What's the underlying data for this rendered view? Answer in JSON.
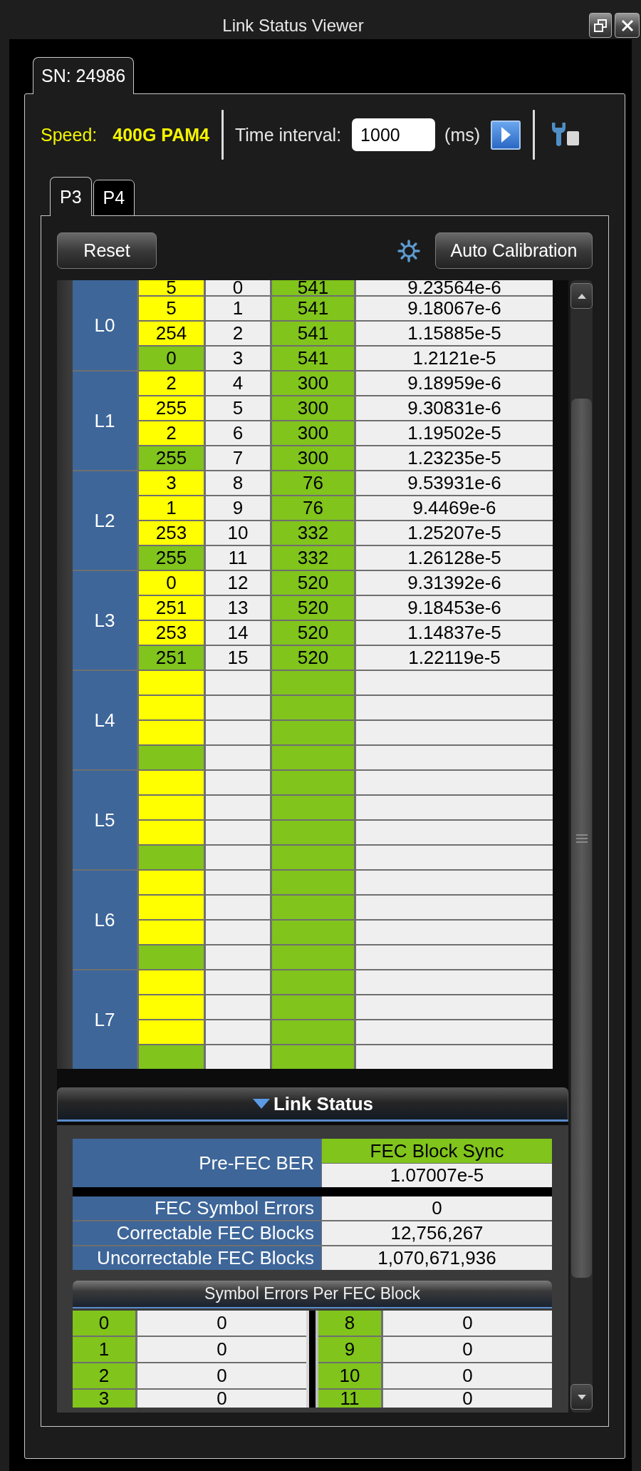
{
  "window": {
    "title": "Link Status Viewer"
  },
  "device_tabs": [
    {
      "label": "SN: 24986",
      "selected": true
    }
  ],
  "toolbar": {
    "speed_label": "Speed:",
    "speed_value": "400G PAM4",
    "interval_label": "Time interval:",
    "interval_value": "1000",
    "interval_unit": "(ms)"
  },
  "port_tabs": [
    {
      "label": "P3",
      "selected": true
    },
    {
      "label": "P4",
      "selected": false
    }
  ],
  "actions": {
    "reset": "Reset",
    "auto_calibration": "Auto Calibration"
  },
  "lanes": [
    {
      "label": "L0",
      "rows": [
        {
          "color": "#ffff00",
          "column_1": "5",
          "column_2": "0",
          "column_3": "541",
          "column_4": "9.23564e-6"
        },
        {
          "color": "#ffff00",
          "column_1": "5",
          "column_2": "1",
          "column_3": "541",
          "column_4": "9.18067e-6"
        },
        {
          "color": "#ffff00",
          "column_1": "254",
          "column_2": "2",
          "column_3": "541",
          "column_4": "1.15885e-5"
        },
        {
          "color": "#80c41c",
          "column_1": "0",
          "column_2": "3",
          "column_3": "541",
          "column_4": "1.2121e-5"
        }
      ]
    },
    {
      "label": "L1",
      "rows": [
        {
          "color": "#ffff00",
          "column_1": "2",
          "column_2": "4",
          "column_3": "300",
          "column_4": "9.18959e-6"
        },
        {
          "color": "#ffff00",
          "column_1": "255",
          "column_2": "5",
          "column_3": "300",
          "column_4": "9.30831e-6"
        },
        {
          "color": "#ffff00",
          "column_1": "2",
          "column_2": "6",
          "column_3": "300",
          "column_4": "1.19502e-5"
        },
        {
          "color": "#80c41c",
          "column_1": "255",
          "column_2": "7",
          "column_3": "300",
          "column_4": "1.23235e-5"
        }
      ]
    },
    {
      "label": "L2",
      "rows": [
        {
          "color": "#ffff00",
          "column_1": "3",
          "column_2": "8",
          "column_3": "76",
          "column_4": "9.53931e-6"
        },
        {
          "color": "#ffff00",
          "column_1": "1",
          "column_2": "9",
          "column_3": "76",
          "column_4": "9.4469e-6"
        },
        {
          "color": "#ffff00",
          "column_1": "253",
          "column_2": "10",
          "column_3": "332",
          "column_4": "1.25207e-5"
        },
        {
          "color": "#80c41c",
          "column_1": "255",
          "column_2": "11",
          "column_3": "332",
          "column_4": "1.26128e-5"
        }
      ]
    },
    {
      "label": "L3",
      "rows": [
        {
          "color": "#ffff00",
          "column_1": "0",
          "column_2": "12",
          "column_3": "520",
          "column_4": "9.31392e-6"
        },
        {
          "color": "#ffff00",
          "column_1": "251",
          "column_2": "13",
          "column_3": "520",
          "column_4": "9.18453e-6"
        },
        {
          "color": "#ffff00",
          "column_1": "253",
          "column_2": "14",
          "column_3": "520",
          "column_4": "1.14837e-5"
        },
        {
          "color": "#80c41c",
          "column_1": "251",
          "column_2": "15",
          "column_3": "520",
          "column_4": "1.22119e-5"
        }
      ]
    },
    {
      "label": "L4",
      "rows": [
        {
          "color": "#ffff00"
        },
        {
          "color": "#ffff00"
        },
        {
          "color": "#ffff00"
        },
        {
          "color": "#80c41c"
        }
      ]
    },
    {
      "label": "L5",
      "rows": [
        {
          "color": "#ffff00"
        },
        {
          "color": "#ffff00"
        },
        {
          "color": "#ffff00"
        },
        {
          "color": "#80c41c"
        }
      ]
    },
    {
      "label": "L6",
      "rows": [
        {
          "color": "#ffff00"
        },
        {
          "color": "#ffff00"
        },
        {
          "color": "#ffff00"
        },
        {
          "color": "#80c41c"
        }
      ]
    },
    {
      "label": "L7",
      "rows": [
        {
          "color": "#ffff00"
        },
        {
          "color": "#ffff00"
        },
        {
          "color": "#ffff00"
        },
        {
          "color": "#80c41c"
        }
      ]
    }
  ],
  "link_status": {
    "title": "Link Status",
    "expanded": true,
    "pre_fec": {
      "label": "Pre-FEC BER",
      "sync_status": "FEC Block Sync",
      "value": "1.07007e-5"
    },
    "metrics": [
      {
        "label": "FEC Symbol Errors",
        "value": "0"
      },
      {
        "label": "Correctable FEC Blocks",
        "value": "12,756,267"
      },
      {
        "label": "Uncorrectable FEC Blocks",
        "value": "1,070,671,936"
      }
    ],
    "symbol_errors": {
      "title": "Symbol Errors Per FEC Block",
      "left": [
        {
          "index": "0",
          "value": "0"
        },
        {
          "index": "1",
          "value": "0"
        },
        {
          "index": "2",
          "value": "0"
        },
        {
          "index": "3",
          "value": "0"
        }
      ],
      "right": [
        {
          "index": "8",
          "value": "0"
        },
        {
          "index": "9",
          "value": "0"
        },
        {
          "index": "10",
          "value": "0"
        },
        {
          "index": "11",
          "value": "0"
        }
      ]
    }
  }
}
